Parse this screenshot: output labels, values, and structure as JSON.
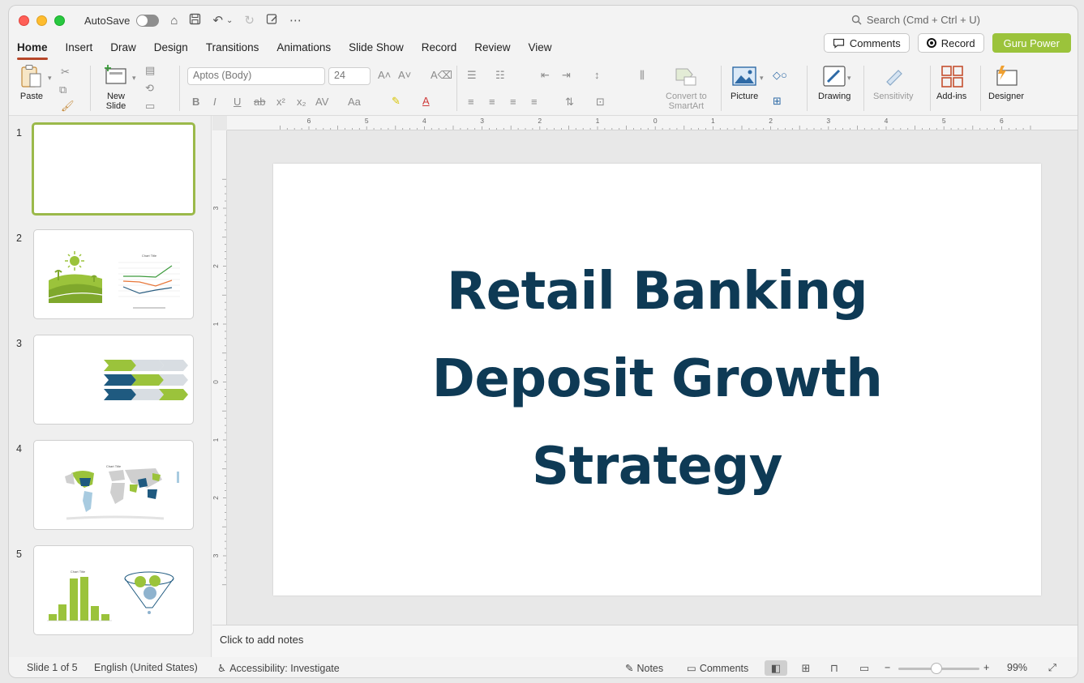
{
  "titlebar": {
    "autosave_label": "AutoSave",
    "search_placeholder": "Search (Cmd + Ctrl + U)"
  },
  "tabs": [
    "Home",
    "Insert",
    "Draw",
    "Design",
    "Transitions",
    "Animations",
    "Slide Show",
    "Record",
    "Review",
    "View"
  ],
  "actions": {
    "comments": "Comments",
    "record": "Record",
    "guru": "Guru Power"
  },
  "ribbon": {
    "paste": "Paste",
    "new_slide_1": "New",
    "new_slide_2": "Slide",
    "font_name": "Aptos (Body)",
    "font_size": "24",
    "convert_1": "Convert to",
    "convert_2": "SmartArt",
    "picture": "Picture",
    "drawing": "Drawing",
    "sensitivity": "Sensitivity",
    "addins": "Add-ins",
    "designer": "Designer"
  },
  "ruler": {
    "h_labels": [
      "6",
      "5",
      "4",
      "3",
      "2",
      "1",
      "0",
      "1",
      "2",
      "3",
      "4",
      "5",
      "6"
    ],
    "v_labels": [
      "3",
      "2",
      "1",
      "0",
      "1",
      "2",
      "3"
    ]
  },
  "slides": [
    {
      "num": "1"
    },
    {
      "num": "2",
      "chart_title": "Chart Title"
    },
    {
      "num": "3"
    },
    {
      "num": "4",
      "chart_title": "Chart Title"
    },
    {
      "num": "5",
      "chart_title": "Chart Title"
    }
  ],
  "slide": {
    "title_line1": "Retail Banking",
    "title_line2": "Deposit Growth",
    "title_line3": "Strategy"
  },
  "notes_placeholder": "Click to add notes",
  "status": {
    "slide_of": "Slide 1 of 5",
    "language": "English (United States)",
    "accessibility": "Accessibility: Investigate",
    "notes": "Notes",
    "comments": "Comments",
    "zoom": "99%"
  },
  "colors": {
    "accent_green": "#9bc33b",
    "title_navy": "#0e3a55",
    "tab_underline": "#b7472a"
  }
}
